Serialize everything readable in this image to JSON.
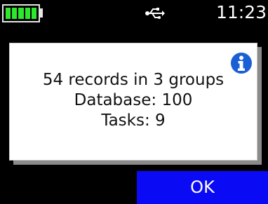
{
  "status_bar": {
    "clock": "11:23",
    "battery_level": 1.0,
    "battery_color": "#2ee82e",
    "usb_icon": "usb-icon"
  },
  "dialog": {
    "icon": "info-icon",
    "lines": [
      "54 records in 3 groups",
      "Database: 100",
      "Tasks: 9"
    ]
  },
  "softkeys": {
    "right_label": "OK",
    "right_color": "#0a0af5"
  }
}
